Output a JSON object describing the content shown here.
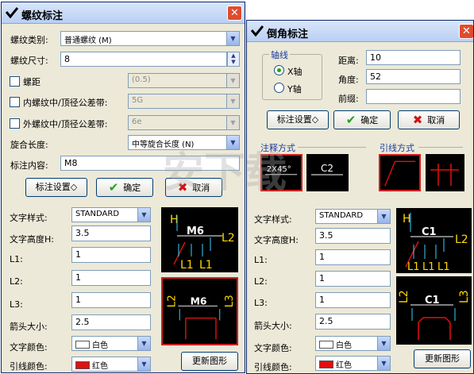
{
  "left": {
    "title": "螺纹标注",
    "type_label": "螺纹类别:",
    "type_value": "普通螺纹 (M)",
    "size_label": "螺纹尺寸:",
    "size_value": "8",
    "pitch_label": "螺距",
    "pitch_value": "(0.5)",
    "inner_tol_label": "内螺纹中/顶径公差带:",
    "inner_tol_value": "5G",
    "outer_tol_label": "外螺纹中/顶径公差带:",
    "outer_tol_value": "6e",
    "length_label": "旋合长度:",
    "length_value": "中等旋合长度 (N)",
    "content_label": "标注内容:",
    "content_value": "M8",
    "settings_button": "标注设置◇",
    "ok_button": "确定",
    "cancel_button": "取消",
    "text_style_label": "文字样式:",
    "text_style_value": "STANDARD",
    "text_height_label": "文字高度H:",
    "text_height_value": "3.5",
    "l1_label": "L1:",
    "l1_value": "1",
    "l2_label": "L2:",
    "l2_value": "1",
    "l3_label": "L3:",
    "l3_value": "1",
    "arrow_label": "箭头大小:",
    "arrow_value": "2.5",
    "text_color_label": "文字颜色:",
    "text_color_value": "白色",
    "leader_color_label": "引线颜色:",
    "leader_color_value": "红色",
    "refresh_button": "更新图形",
    "preview1": {
      "h": "H",
      "m": "M6",
      "l2": "L2",
      "l1a": "L1",
      "l1b": "L1"
    },
    "preview2": {
      "l2": "L2",
      "m": "M6",
      "l3": "L3"
    }
  },
  "right": {
    "title": "倒角标注",
    "axis_group": "轴线",
    "x_axis": "X轴",
    "y_axis": "Y轴",
    "distance_label": "距离:",
    "distance_value": "10",
    "angle_label": "角度:",
    "angle_value": "52",
    "prefix_label": "前缀:",
    "prefix_value": "",
    "settings_button": "标注设置◇",
    "ok_button": "确定",
    "cancel_button": "取消",
    "annot_mode_label": "注释方式",
    "leader_mode_label": "引线方式",
    "annot1": "2X45°",
    "annot2": "C2",
    "text_style_label": "文字样式:",
    "text_style_value": "STANDARD",
    "text_height_label": "文字高度H:",
    "text_height_value": "3.5",
    "l1_label": "L1:",
    "l1_value": "1",
    "l2_label": "L2:",
    "l2_value": "1",
    "l3_label": "L3:",
    "l3_value": "1",
    "arrow_label": "箭头大小:",
    "arrow_value": "2.5",
    "text_color_label": "文字颜色:",
    "text_color_value": "白色",
    "leader_color_label": "引线颜色:",
    "leader_color_value": "红色",
    "refresh_button": "更新图形",
    "preview1": {
      "h": "H",
      "c": "C1",
      "l2": "L2",
      "l1a": "L1",
      "l1b": "L1",
      "l1c": "L1"
    },
    "preview2": {
      "l2": "L2",
      "c": "C1",
      "l3": "L3"
    }
  },
  "watermark": "安下载",
  "colors": {
    "white_swatch": "#ffffff",
    "red_swatch": "#e01010",
    "accent": "#0a246a"
  }
}
